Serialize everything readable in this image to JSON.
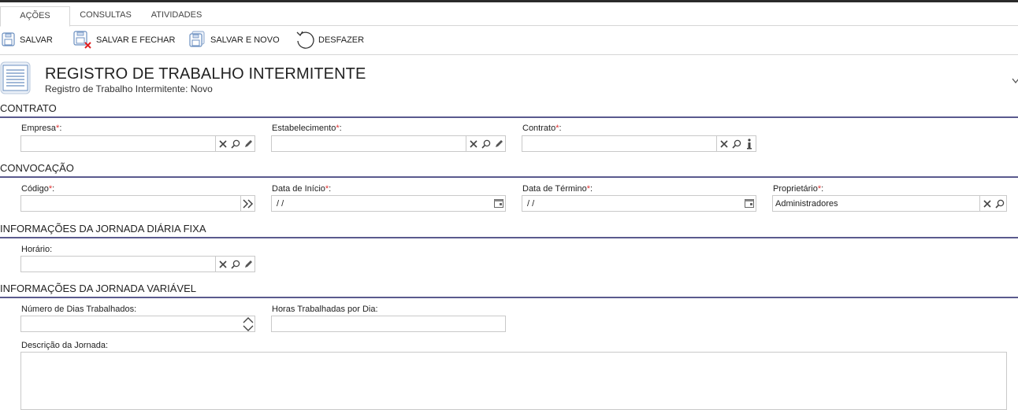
{
  "tabs": [
    {
      "label": "AÇÕES"
    },
    {
      "label": "CONSULTAS"
    },
    {
      "label": "ATIVIDADES"
    }
  ],
  "toolbar": {
    "save": "SALVAR",
    "save_close": "SALVAR E FECHAR",
    "save_new": "SALVAR E NOVO",
    "undo": "DESFAZER"
  },
  "header": {
    "title": "REGISTRO DE TRABALHO INTERMITENTE",
    "subtitle": "Registro de Trabalho Intermitente: Novo"
  },
  "sections": {
    "contrato": "CONTRATO",
    "convocacao": "CONVOCAÇÃO",
    "jornada_fixa": "INFORMAÇÕES DA JORNADA DIÁRIA FIXA",
    "jornada_variavel": "INFORMAÇÕES DA JORNADA VARIÁVEL"
  },
  "fields": {
    "empresa": {
      "label": "Empresa",
      "value": ""
    },
    "estabelecimento": {
      "label": "Estabelecimento",
      "value": ""
    },
    "contrato": {
      "label": "Contrato",
      "value": ""
    },
    "codigo": {
      "label": "Código",
      "value": ""
    },
    "data_inicio": {
      "label": "Data de Início",
      "value": " /  /"
    },
    "data_termino": {
      "label": "Data de Término",
      "value": " /  /"
    },
    "proprietario": {
      "label": "Proprietário",
      "value": "Administradores"
    },
    "horario": {
      "label": "Horário",
      "value": ""
    },
    "num_dias": {
      "label": "Número de Dias Trabalhados",
      "value": ""
    },
    "horas_dia": {
      "label": "Horas Trabalhadas por Dia",
      "value": ""
    },
    "descricao": {
      "label": "Descrição da Jornada",
      "value": ""
    }
  },
  "required_mark": "*",
  "label_suffix": ":",
  "colors": {
    "section_rule": "#5a5a8e",
    "required": "#e03030",
    "save_icon": "#3a6fb0",
    "close_x": "#e02020"
  },
  "icons": [
    "save-icon",
    "save-close-icon",
    "save-new-icon",
    "undo-icon",
    "form-list-icon",
    "clear-icon",
    "search-icon",
    "edit-icon",
    "info-icon",
    "calendar-icon",
    "double-chevron-icon",
    "spinner-up-icon",
    "spinner-down-icon",
    "chevron-down-icon"
  ]
}
